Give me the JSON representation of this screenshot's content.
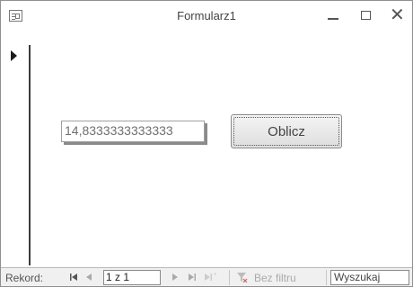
{
  "window": {
    "title": "Formularz1"
  },
  "form": {
    "result_value": "14,8333333333333",
    "compute_button_label": "Oblicz"
  },
  "navigation": {
    "record_label": "Rekord:",
    "first_icon": "⏮",
    "prev_icon": "◀",
    "record_value": "1 z 1",
    "next_icon": "▶",
    "last_icon": "⏭",
    "new_icon": "▶*",
    "filter_label": "Bez filtru",
    "search_placeholder": "Wyszukaj"
  }
}
